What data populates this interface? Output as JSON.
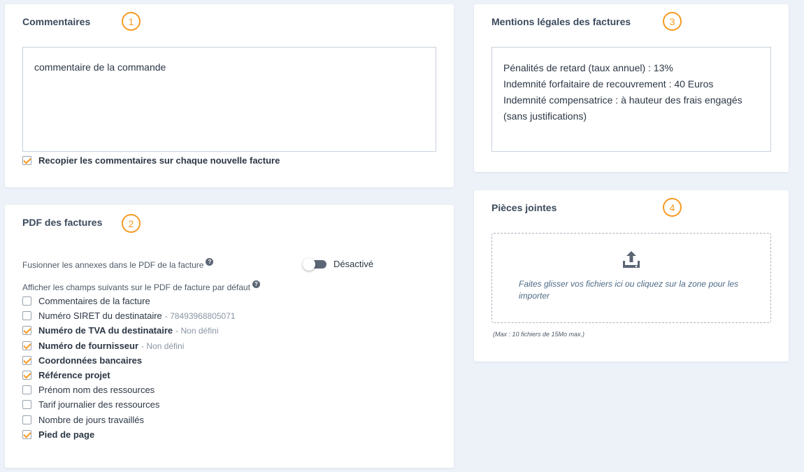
{
  "comments_card": {
    "title": "Commentaires",
    "step": "1",
    "textarea_value": "commentaire de la commande",
    "copy_checkbox_label": "Recopier les commentaires sur chaque nouvelle facture",
    "copy_checkbox_checked": true
  },
  "legal_card": {
    "title": "Mentions légales des factures",
    "step": "3",
    "lines": [
      "Pénalités de retard (taux annuel) : 13%",
      "Indemnité forfaitaire de recouvrement : 40 Euros",
      "Indemnité compensatrice : à hauteur des frais engagés",
      "(sans justifications)"
    ]
  },
  "pdf_card": {
    "title": "PDF des factures",
    "step": "2",
    "merge_label": "Fusionner les annexes dans le PDF de la facture",
    "merge_help": "?",
    "merge_status": "Désactivé",
    "merge_enabled": false,
    "fields_label": "Afficher les champs suivants sur le PDF de facture par défaut",
    "fields_help": "?",
    "fields": [
      {
        "label": "Commentaires de la facture",
        "checked": false,
        "extra": ""
      },
      {
        "label": "Numéro SIRET du destinataire",
        "checked": false,
        "extra": "- 78493968805071"
      },
      {
        "label": "Numéro de TVA du destinataire",
        "checked": true,
        "extra": "- Non défini"
      },
      {
        "label": "Numéro de fournisseur",
        "checked": true,
        "extra": "- Non défini"
      },
      {
        "label": "Coordonnées bancaires",
        "checked": true,
        "extra": ""
      },
      {
        "label": "Référence projet",
        "checked": true,
        "extra": ""
      },
      {
        "label": "Prénom nom des ressources",
        "checked": false,
        "extra": ""
      },
      {
        "label": "Tarif journalier des ressources",
        "checked": false,
        "extra": ""
      },
      {
        "label": "Nombre de jours travaillés",
        "checked": false,
        "extra": ""
      },
      {
        "label": "Pied de page",
        "checked": true,
        "extra": ""
      }
    ]
  },
  "attachments_card": {
    "title": "Pièces jointes",
    "step": "4",
    "upload_icon": "upload-icon",
    "dropzone_text_line1": "Faites glisser vos fichiers ici ou cliquez sur la zone pour les",
    "dropzone_text_line2": "importer",
    "limit_note": "(Max : 10 fichiers de 15Mo max.)"
  },
  "colors": {
    "accent": "#f59a23",
    "background": "#edf2f9",
    "title": "#3b4a5c",
    "toggle_off": "#5b6675"
  }
}
